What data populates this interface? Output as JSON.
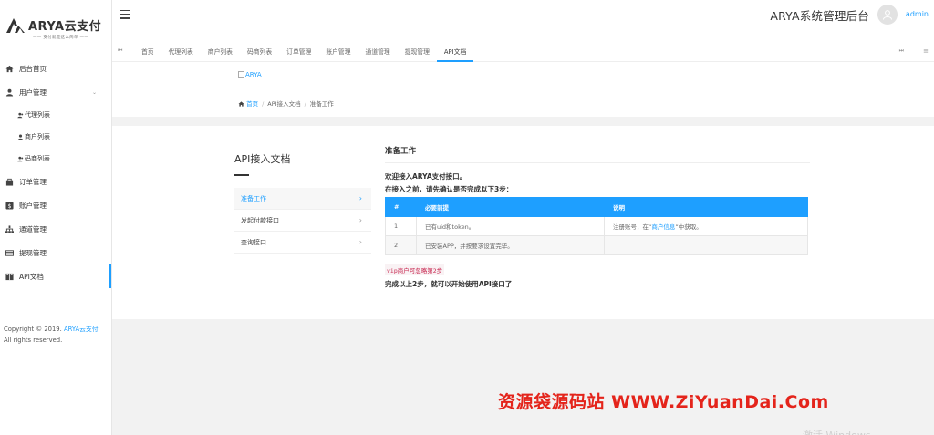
{
  "app": {
    "logo_text": "ARYA云支付",
    "logo_sub": "—— 支付就是这么简单 ——",
    "header_title": "ARYA系统管理后台",
    "username": "admin"
  },
  "sidebar": {
    "items": [
      {
        "label": "后台首页",
        "icon": "home-icon"
      },
      {
        "label": "用户管理",
        "icon": "user-icon",
        "caret": "⌄"
      },
      {
        "label": "订单管理",
        "icon": "bag-icon"
      },
      {
        "label": "账户管理",
        "icon": "dollar-icon"
      },
      {
        "label": "通道管理",
        "icon": "tree-icon"
      },
      {
        "label": "提现管理",
        "icon": "card-icon"
      },
      {
        "label": "API文档",
        "icon": "book-icon"
      }
    ],
    "subitems": [
      {
        "label": "代理列表"
      },
      {
        "label": "商户列表"
      },
      {
        "label": "码商列表"
      }
    ],
    "copyright_prefix": "Copyright © 2019.",
    "copyright_link": "ARYA云支付",
    "copyright_suffix": "All rights reserved."
  },
  "tabs": {
    "nav_left": "⏮",
    "nav_right": "⏭",
    "menu": "≡",
    "items": [
      {
        "label": "首页"
      },
      {
        "label": "代理列表"
      },
      {
        "label": "商户列表"
      },
      {
        "label": "码商列表"
      },
      {
        "label": "订单管理"
      },
      {
        "label": "账户管理"
      },
      {
        "label": "通道管理"
      },
      {
        "label": "提现管理"
      },
      {
        "label": "API文档"
      }
    ]
  },
  "content": {
    "brand_alt": "ARYA",
    "breadcrumb": {
      "home": "首页",
      "level2": "API接入文档",
      "level3": "准备工作",
      "sep": "/"
    },
    "doc_nav": {
      "title": "API接入文档",
      "links": [
        {
          "label": "准备工作"
        },
        {
          "label": "发起付款接口"
        },
        {
          "label": "查询接口"
        }
      ],
      "arrow": "›"
    },
    "doc": {
      "section_title": "准备工作",
      "intro_line1": "欢迎接入ARYA支付接口。",
      "intro_line2": "在接入之前，请先确认是否完成以下3步：",
      "table_headers": [
        "#",
        "必要前提",
        "说明"
      ],
      "rows": [
        {
          "num": "1",
          "req": "已有uid和token。",
          "desc_prefix": "注册账号，在“",
          "desc_link": "商户信息",
          "desc_suffix": "”中获取。"
        },
        {
          "num": "2",
          "req": "已安装APP，并按要求设置完毕。",
          "desc_prefix": "",
          "desc_link": "",
          "desc_suffix": ""
        }
      ],
      "vip_tip": "vip商户可忽略第2步",
      "done": "完成以上2步，就可以开始使用API接口了"
    }
  },
  "watermark": "资源袋源码站 WWW.ZiYuanDai.Com",
  "win_watermark": "激活 Windows"
}
